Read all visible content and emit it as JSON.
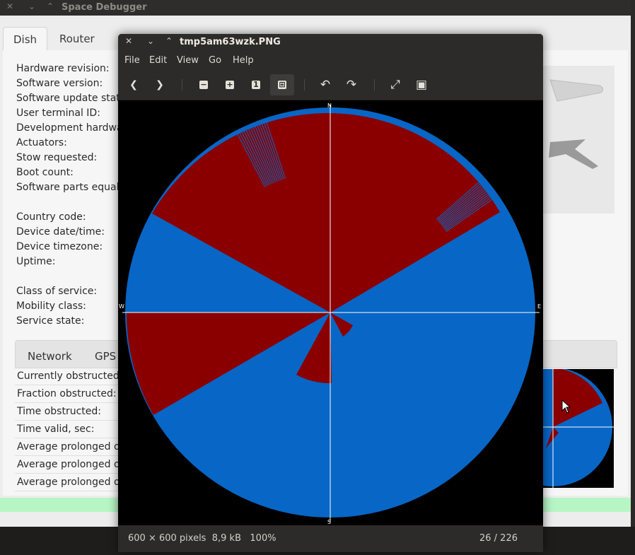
{
  "background_app": {
    "title": "Space Debugger",
    "tabs": [
      {
        "label": "Dish"
      },
      {
        "label": "Router"
      }
    ],
    "info_labels": [
      "Hardware revision:",
      "Software version:",
      "Software update state",
      "User terminal ID:",
      "Development hardwar",
      "Actuators:",
      "Stow requested:",
      "Boot count:",
      "Software parts equal:",
      "",
      "Country code:",
      "Device date/time:",
      "Device timezone:",
      "Uptime:",
      "",
      "Class of service:",
      "Mobility class:",
      "Service state:"
    ],
    "subtabs": [
      {
        "label": "Network"
      },
      {
        "label": "GPS"
      }
    ],
    "obstruction_labels": [
      "Currently obstructed:",
      "Fraction obstructed:",
      "Time obstructed:",
      "Time valid, sec:",
      "Average prolonged ob",
      "Average prolonged ob",
      "Average prolonged ob"
    ]
  },
  "viewer": {
    "window_title": "tmp5am63wzk.PNG",
    "menu": [
      "File",
      "Edit",
      "View",
      "Go",
      "Help"
    ],
    "toolbar": [
      {
        "name": "back-icon",
        "glyph": "❮"
      },
      {
        "name": "forward-icon",
        "glyph": "❯"
      },
      {
        "name": "zoom-out-icon",
        "glyph": "−"
      },
      {
        "name": "zoom-in-icon",
        "glyph": "+"
      },
      {
        "name": "zoom-1-icon",
        "glyph": "1"
      },
      {
        "name": "zoom-fit-icon",
        "glyph": "⊞"
      },
      {
        "name": "rotate-left-icon",
        "glyph": "↶"
      },
      {
        "name": "rotate-right-icon",
        "glyph": "↷"
      },
      {
        "name": "fullscreen-icon",
        "glyph": "⤢"
      },
      {
        "name": "slideshow-icon",
        "glyph": "▣"
      }
    ],
    "status": {
      "dimensions": "600 × 600 pixels",
      "size": "8,9 kB",
      "zoom": "100%",
      "position": "26 / 226"
    },
    "compass": {
      "north": "N",
      "south": "S",
      "east": "E",
      "west": "W"
    },
    "colors": {
      "clear": "#0866c6",
      "obstructed": "#8a0000",
      "background": "#000000",
      "crosshair": "#ffffff"
    }
  }
}
